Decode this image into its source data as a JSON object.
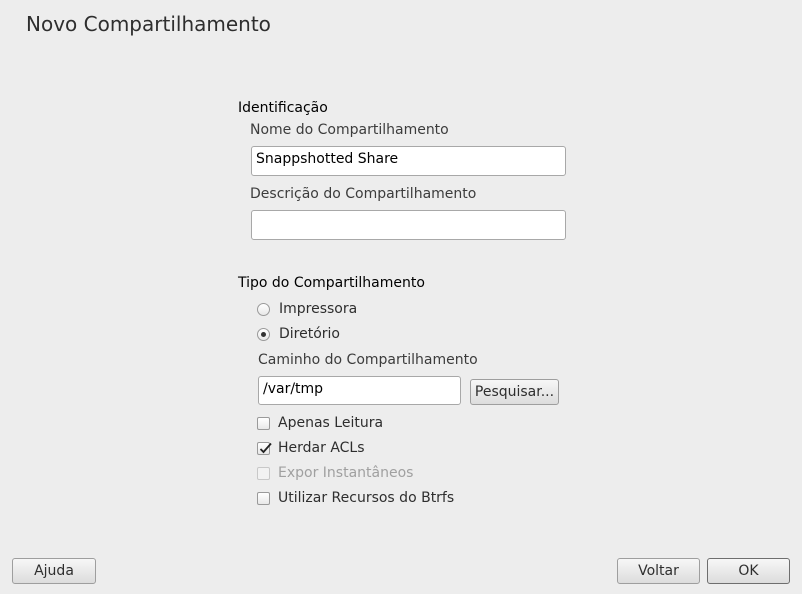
{
  "window": {
    "title": "Novo Compartilhamento"
  },
  "identification": {
    "section_label": "Identificação",
    "name_label": "Nome do Compartilhamento",
    "name_value": "Snappshotted Share",
    "description_label": "Descrição do Compartilhamento",
    "description_value": ""
  },
  "share_type": {
    "section_label": "Tipo do Compartilhamento",
    "options": [
      {
        "label": "Impressora",
        "selected": false
      },
      {
        "label": "Diretório",
        "selected": true
      }
    ],
    "path_label": "Caminho do Compartilhamento",
    "path_value": "/var/tmp",
    "browse_label": "Pesquisar...",
    "checkboxes": [
      {
        "label": "Apenas Leitura",
        "checked": false,
        "enabled": true
      },
      {
        "label": "Herdar ACLs",
        "checked": true,
        "enabled": true
      },
      {
        "label": "Expor Instantâneos",
        "checked": false,
        "enabled": false
      },
      {
        "label": "Utilizar Recursos do Btrfs",
        "checked": false,
        "enabled": true
      }
    ]
  },
  "footer": {
    "help_label": "Ajuda",
    "back_label": "Voltar",
    "ok_label": "OK"
  }
}
